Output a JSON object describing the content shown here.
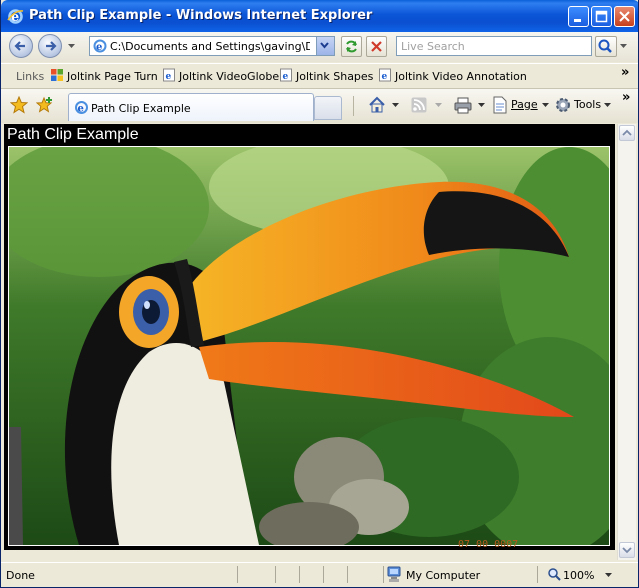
{
  "window": {
    "title": "Path Clip Example - Windows Internet Explorer"
  },
  "address": {
    "url": "C:\\Documents and Settings\\gaving\\Desktop\\"
  },
  "search": {
    "placeholder": "Live Search"
  },
  "links_bar": {
    "label": "Links",
    "items": [
      {
        "label": "Joltink Page Turn"
      },
      {
        "label": "Joltink VideoGlobe"
      },
      {
        "label": "Joltink Shapes"
      },
      {
        "label": "Joltink Video Annotation"
      }
    ],
    "overflow": "»"
  },
  "tabs": [
    {
      "label": "Path Clip Example"
    }
  ],
  "command_bar": {
    "page": "Page",
    "tools": "Tools",
    "overflow": "»"
  },
  "page": {
    "heading": "Path Clip Example",
    "photo_stamp": "07 00 0007"
  },
  "status_bar": {
    "text": "Done",
    "zone": "My Computer",
    "zoom": "100%"
  },
  "colors": {
    "titlebar": "#0a56d8",
    "content_bg": "#000000",
    "beak": "#f2a020"
  }
}
